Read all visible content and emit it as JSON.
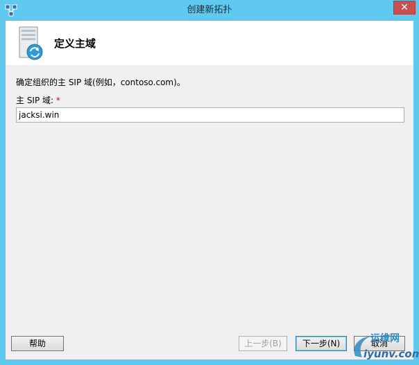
{
  "window": {
    "title": "创建新拓扑",
    "close_glyph": "✕"
  },
  "header": {
    "title": "定义主域"
  },
  "form": {
    "description": "确定组织的主 SIP 域(例如，contoso.com)。",
    "domain_label": "主 SIP 域:",
    "required_mark": "*",
    "domain_value": "jacksi.win"
  },
  "buttons": {
    "help": "帮助",
    "prev": "上一步(B)",
    "next": "下一步(N)",
    "cancel": "取消"
  },
  "watermark": {
    "main": "运维网",
    "sub": "iyunv.com"
  },
  "colors": {
    "title_bar": "#5fc9ef",
    "close": "#c75050",
    "body": "#f0f0f0"
  },
  "icons": {
    "app": "topology-icon",
    "header": "server-sync-icon"
  }
}
